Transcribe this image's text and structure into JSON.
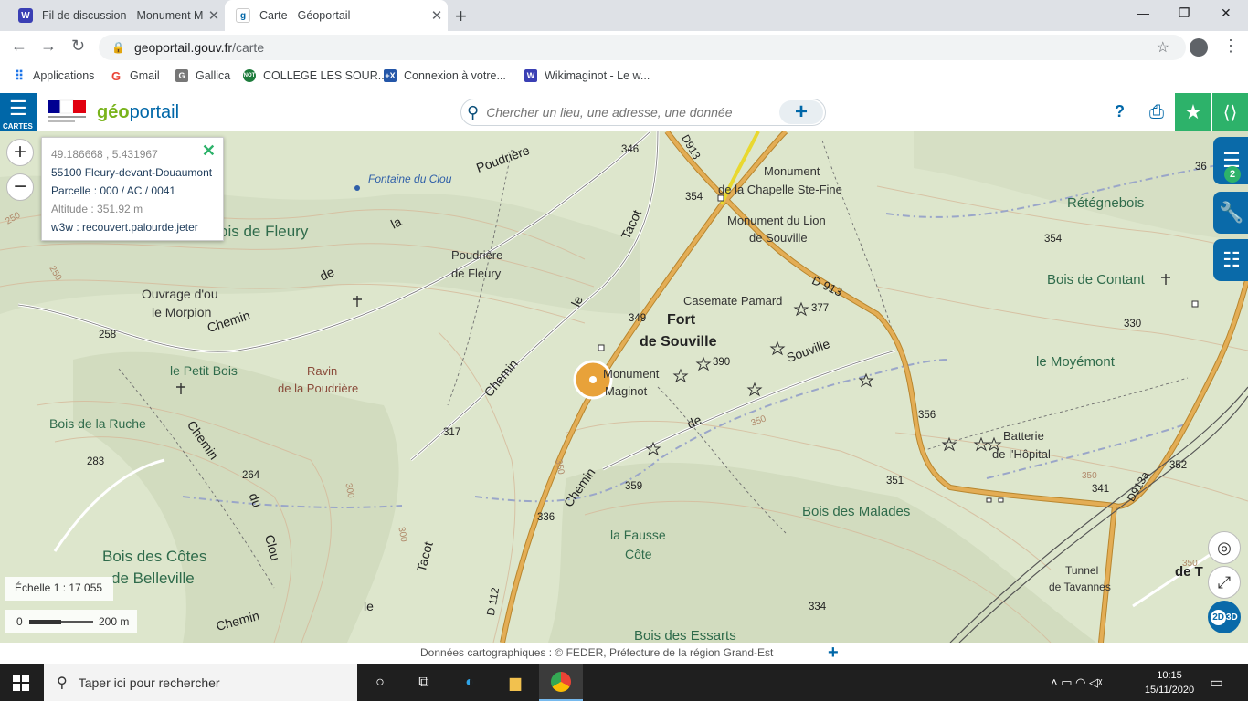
{
  "browser": {
    "tabs": [
      {
        "title": "Fil de discussion - Monument Ma",
        "icon": "W"
      },
      {
        "title": "Carte - Géoportail",
        "icon": "geo"
      }
    ],
    "url_host": "geoportail.gouv.fr",
    "url_path": "/carte",
    "bookmarks": [
      {
        "label": "Applications",
        "icon": "apps-grid-icon"
      },
      {
        "label": "Gmail",
        "icon": "G"
      },
      {
        "label": "Gallica",
        "icon": "G"
      },
      {
        "label": "COLLEGE LES SOUR...",
        "icon": "NOT"
      },
      {
        "label": "Connexion à votre...",
        "icon": "+X"
      },
      {
        "label": "Wikimaginot - Le w...",
        "icon": "W"
      }
    ]
  },
  "geoportail": {
    "menu_label": "CARTES",
    "logo_text_geo": "géo",
    "logo_text_portail": "portail",
    "search_placeholder": "Chercher un lieu, une adresse, une donnée",
    "help": "?",
    "layers_count": "2"
  },
  "popup": {
    "coords": "49.186668 , 5.431967",
    "address": "55100 Fleury-devant-Douaumont",
    "parcel": "Parcelle : 000 / AC / 0041",
    "altitude": "Altitude : 351.92 m",
    "w3w": "w3w : recouvert.palourde.jeter"
  },
  "scale": {
    "label": "Échelle 1 :  17 055",
    "bar_zero": "0",
    "bar_length": "200 m"
  },
  "view_toggle": {
    "a": "2D",
    "b": "3D"
  },
  "attribution": "Données cartographiques : ©   FEDER,  Préfecture de la région Grand-Est",
  "map_labels": {
    "fontaine": "Fontaine du Clou",
    "bois_fleury": "ois de Fleury",
    "poudriere_road": "Poudrière",
    "la": "la",
    "de": "de",
    "chemin1": "Chemin",
    "ouvrage": "Ouvrage d'ou",
    "morpion": "le Morpion",
    "poudriere_fleury": "Poudrière",
    "de_fleury": "de Fleury",
    "tacot": "Tacot",
    "le": "le",
    "chemin2": "Chemin",
    "petit_bois": "le Petit Bois",
    "ravin": "Ravin",
    "de_la_poudriere": "de la Poudrière",
    "bois_ruche": "Bois de la Ruche",
    "chemin3": "Chemin",
    "du": "du",
    "clou": "Clou",
    "bois_cotes": "Bois des Côtes",
    "de_belleville": "de Belleville",
    "tacot2": "Tacot",
    "le2": "le",
    "chemin4": "Chemin",
    "d112": "D 112",
    "d913_top": "D913",
    "d913": "D 913",
    "d913a": "D913a",
    "mon_chap1": "Monument",
    "mon_chap2": "de la Chapelle Ste-Fine",
    "mon_lion1": "Monument du Lion",
    "mon_lion2": "de Souville",
    "casemate": "Casemate Pamard",
    "fort1": "Fort",
    "fort2": "de Souville",
    "mon_mag1": "Monument",
    "mon_mag2": "Maginot",
    "souville": "Souville",
    "de2": "de",
    "chemin5": "Chemin",
    "fausse1": "la Fausse",
    "fausse2": "Côte",
    "bois_malades": "Bois des Malades",
    "bois_essarts": "Bois des Essarts",
    "retegnebois": "Rétégnebois",
    "bois_contant": "Bois de Contant",
    "moyemont": "le Moyémont",
    "batterie1": "Batterie",
    "batterie2": "de l'Hôpital",
    "tunnel1": "Tunnel",
    "tunnel2": "de Tavannes",
    "de_t": "de T",
    "alt_346": "346",
    "alt_354a": "354",
    "alt_349": "349",
    "alt_377": "377",
    "alt_390": "390",
    "alt_317": "317",
    "alt_359": "359",
    "alt_336": "336",
    "alt_258": "258",
    "alt_283": "283",
    "alt_264": "264",
    "alt_334": "334",
    "alt_354b": "354",
    "alt_330": "330",
    "alt_356": "356",
    "alt_351": "351",
    "alt_341": "341",
    "alt_352": "352",
    "alt_36": "36",
    "c250a": "250",
    "c250b": "250",
    "c300a": "300",
    "c300b": "300",
    "c350a": "350",
    "c350b": "350",
    "c350c": "350",
    "c350d": "350"
  },
  "taskbar": {
    "search_placeholder": "Taper ici pour rechercher",
    "time": "10:15",
    "date": "15/11/2020"
  },
  "colors": {
    "map_green": "#dde6cc",
    "road_orange": "#d9a24a",
    "geoportail_blue": "#0067a8",
    "action_green": "#2db26a"
  }
}
